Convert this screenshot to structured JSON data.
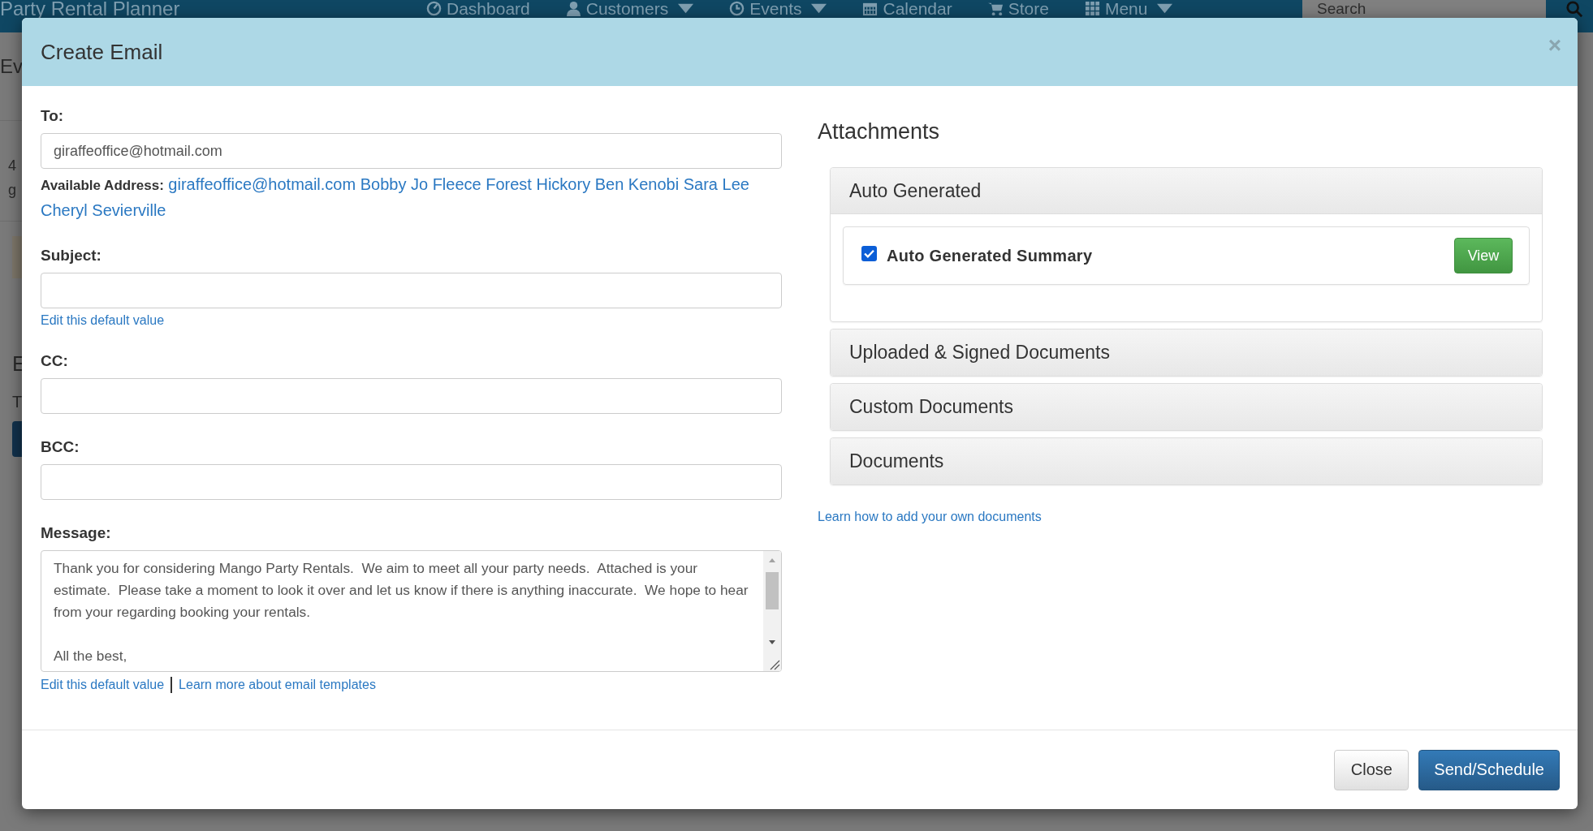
{
  "navbar": {
    "brand": "Party Rental Planner",
    "items": [
      {
        "label": "Dashboard",
        "dropdown": false
      },
      {
        "label": "Customers",
        "dropdown": true
      },
      {
        "label": "Events",
        "dropdown": true
      },
      {
        "label": "Calendar",
        "dropdown": false
      },
      {
        "label": "Store",
        "dropdown": false
      },
      {
        "label": "Menu",
        "dropdown": true
      }
    ],
    "search": {
      "placeholder": "Search"
    }
  },
  "background": {
    "heading": "Ev",
    "card_lines": [
      "4",
      "g"
    ],
    "section_heading": "E",
    "section_text": "T"
  },
  "modal": {
    "title": "Create Email",
    "close": "×",
    "to": {
      "label": "To:",
      "value": "giraffeoffice@hotmail.com"
    },
    "available": {
      "label": "Available Address:",
      "addresses": [
        "giraffeoffice@hotmail.com",
        "Bobby Jo Fleece",
        "Forest Hickory",
        "Ben Kenobi",
        "Sara Lee",
        "Cheryl Sevierville"
      ]
    },
    "fields": [
      {
        "label": "Subject:",
        "links": [
          "Edit this default value"
        ]
      },
      {
        "label": "CC:"
      },
      {
        "label": "BCC:"
      }
    ],
    "message": {
      "label": "Message:",
      "value": "Thank you for considering Mango Party Rentals.  We aim to meet all your party needs.  Attached is your estimate.  Please take a moment to look it over and let us know if there is anything inaccurate.  We hope to hear from your regarding booking your rentals.\n\nAll the best,",
      "links": [
        "Edit this default value",
        "Learn more about email templates"
      ]
    },
    "attachments": {
      "title": "Attachments",
      "panels": [
        {
          "title": "Auto Generated",
          "expanded": true,
          "items": [
            {
              "label": "Auto Generated Summary",
              "checked": true,
              "button": "View"
            }
          ]
        },
        {
          "title": "Uploaded & Signed Documents",
          "expanded": false
        },
        {
          "title": "Custom Documents",
          "expanded": false
        },
        {
          "title": "Documents",
          "expanded": false
        }
      ],
      "help_link": "Learn how to add your own documents"
    },
    "buttons": [
      {
        "label": "Close",
        "kind": "default"
      },
      {
        "label": "Send/Schedule",
        "kind": "primary"
      }
    ]
  }
}
